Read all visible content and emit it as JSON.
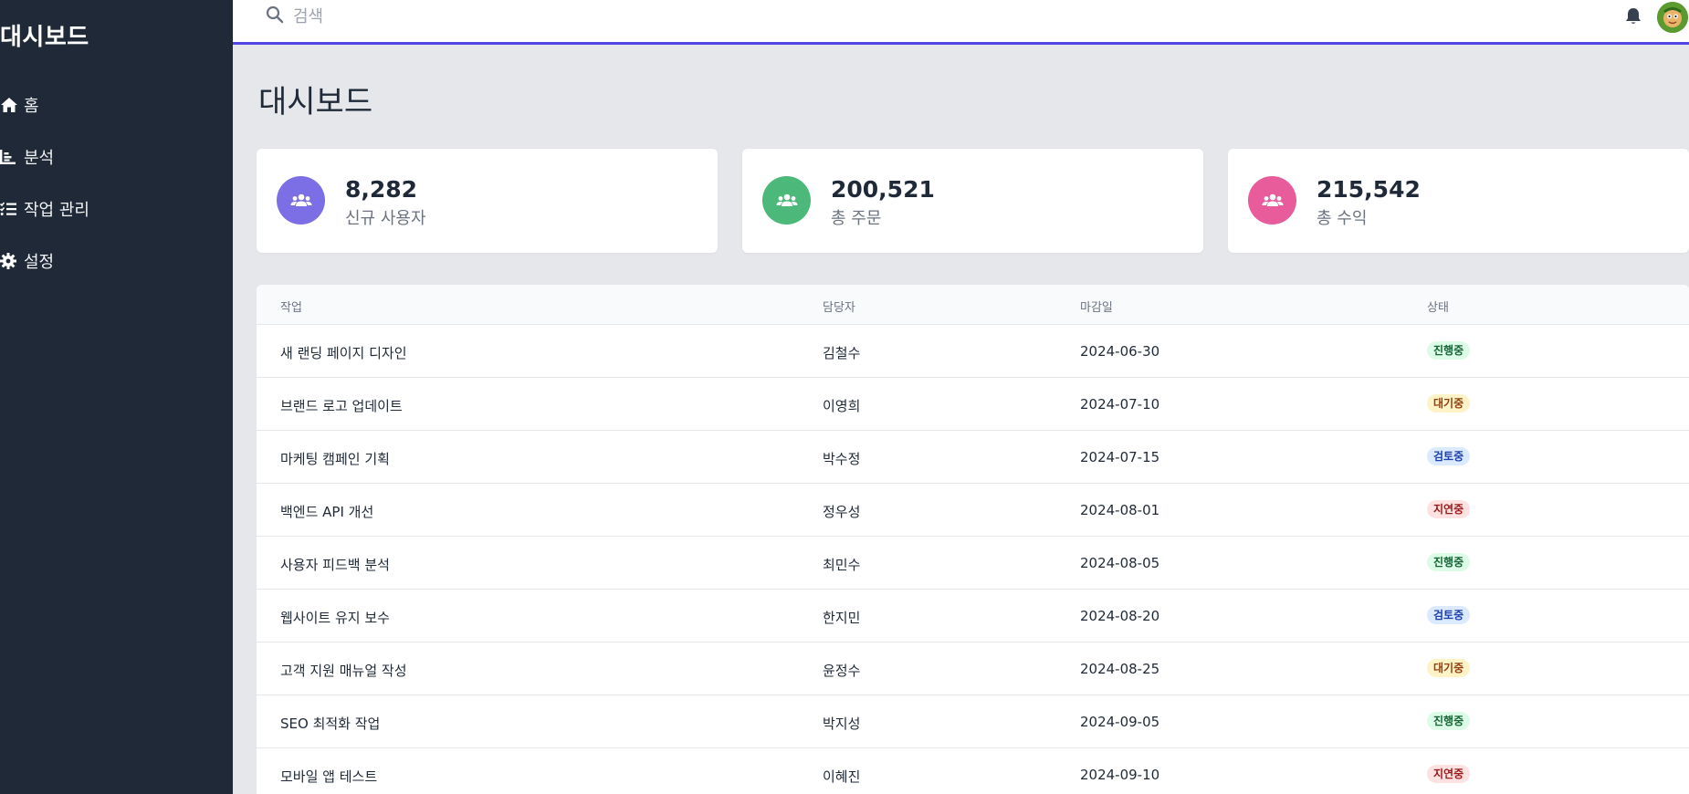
{
  "sidebar": {
    "brand": "대시보드",
    "items": [
      {
        "label": "홈",
        "icon": "home-icon"
      },
      {
        "label": "분석",
        "icon": "chart-icon"
      },
      {
        "label": "작업 관리",
        "icon": "tasks-icon"
      },
      {
        "label": "설정",
        "icon": "gear-icon"
      }
    ]
  },
  "topbar": {
    "search_placeholder": "검색",
    "bell_icon": "bell-icon",
    "avatar_icon": "avatar"
  },
  "main": {
    "title": "대시보드",
    "stats": [
      {
        "value": "8,282",
        "label": "신규 사용자",
        "color": "#7c6fe6"
      },
      {
        "value": "200,521",
        "label": "총 주문",
        "color": "#4cb87a"
      },
      {
        "value": "215,542",
        "label": "총 수익",
        "color": "#e85c9c"
      }
    ],
    "table": {
      "headers": [
        "작업",
        "담당자",
        "마감일",
        "상태"
      ],
      "rows": [
        {
          "task": "새 랜딩 페이지 디자인",
          "owner": "김철수",
          "due": "2024-06-30",
          "status": "진행중"
        },
        {
          "task": "브랜드 로고 업데이트",
          "owner": "이영희",
          "due": "2024-07-10",
          "status": "대기중"
        },
        {
          "task": "마케팅 캠페인 기획",
          "owner": "박수정",
          "due": "2024-07-15",
          "status": "검토중"
        },
        {
          "task": "백엔드 API 개선",
          "owner": "정우성",
          "due": "2024-08-01",
          "status": "지연중"
        },
        {
          "task": "사용자 피드백 분석",
          "owner": "최민수",
          "due": "2024-08-05",
          "status": "진행중"
        },
        {
          "task": "웹사이트 유지 보수",
          "owner": "한지민",
          "due": "2024-08-20",
          "status": "검토중"
        },
        {
          "task": "고객 지원 매뉴얼 작성",
          "owner": "윤정수",
          "due": "2024-08-25",
          "status": "대기중"
        },
        {
          "task": "SEO 최적화 작업",
          "owner": "박지성",
          "due": "2024-09-05",
          "status": "진행중"
        },
        {
          "task": "모바일 앱 테스트",
          "owner": "이혜진",
          "due": "2024-09-10",
          "status": "지연중"
        }
      ]
    },
    "status_colors": {
      "진행중": {
        "bg": "#dcfce7",
        "fg": "#166534"
      },
      "대기중": {
        "bg": "#fef3c7",
        "fg": "#92400e"
      },
      "검토중": {
        "bg": "#dbeafe",
        "fg": "#1e40af"
      },
      "지연중": {
        "bg": "#fee2e2",
        "fg": "#991b1b"
      }
    }
  }
}
